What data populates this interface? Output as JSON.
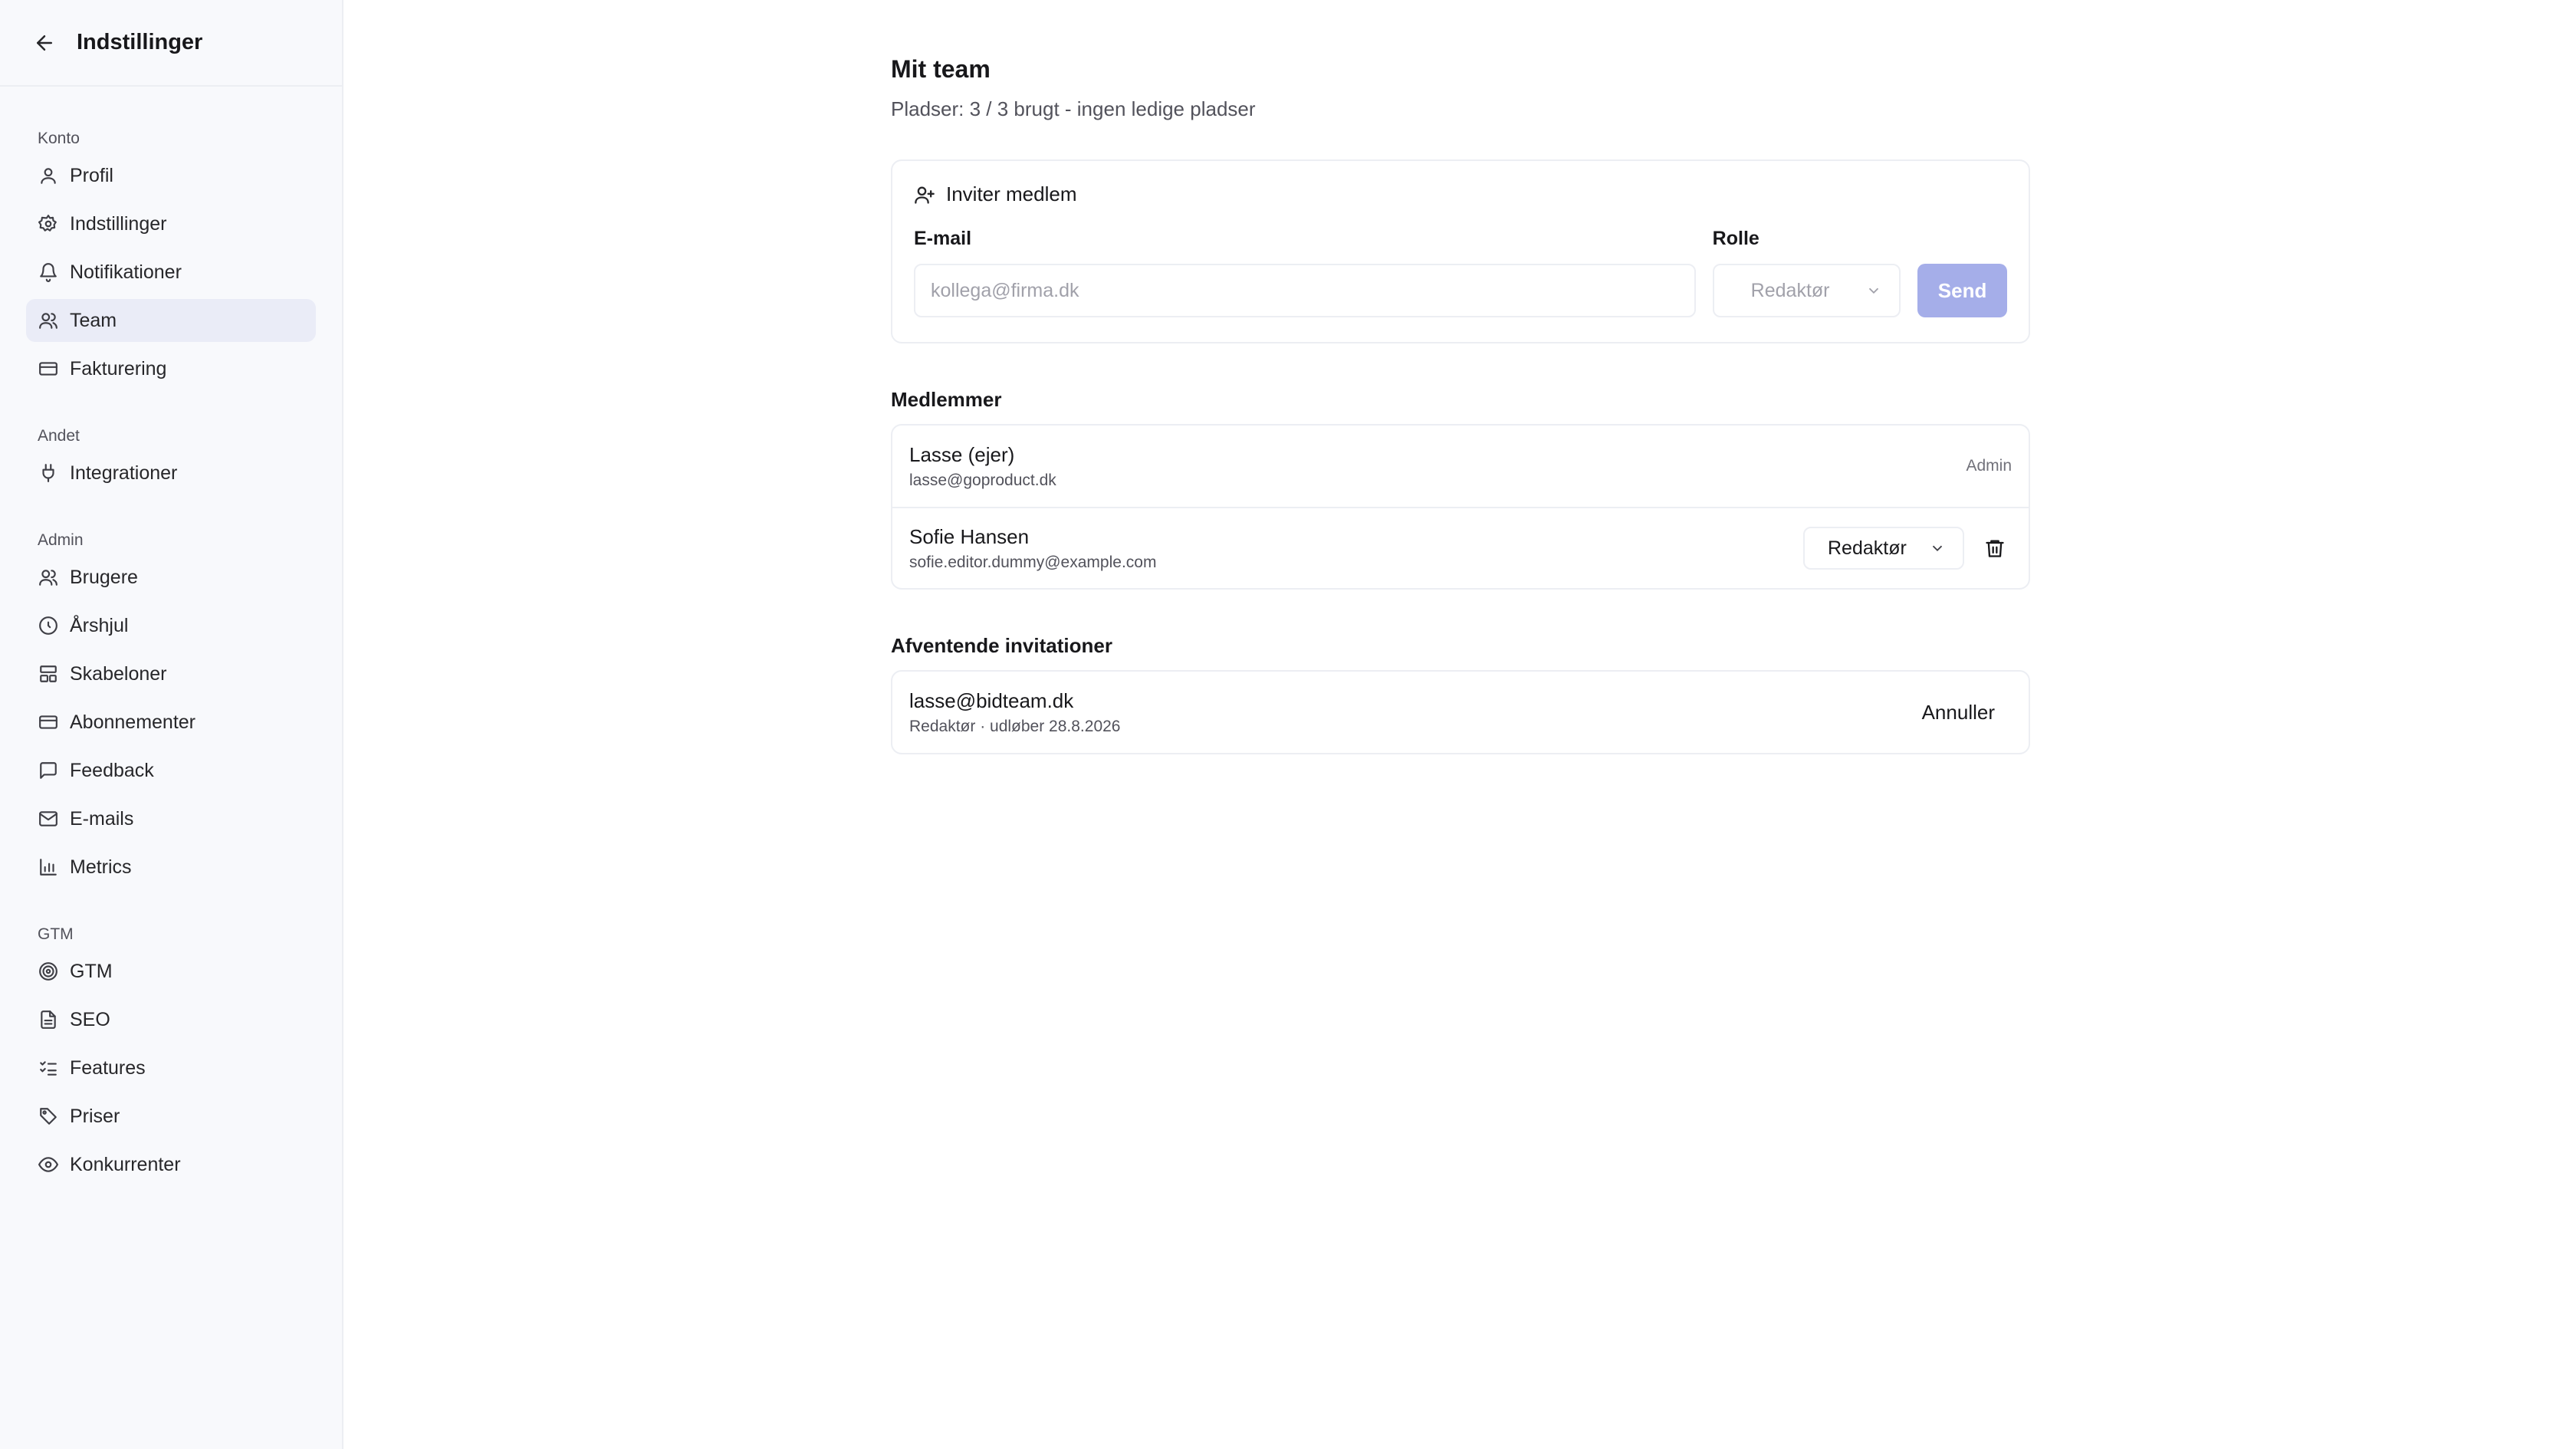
{
  "sidebar": {
    "title": "Indstillinger",
    "sections": [
      {
        "heading": "Konto",
        "items": [
          {
            "label": "Profil",
            "icon": "user-icon"
          },
          {
            "label": "Indstillinger",
            "icon": "gear-icon"
          },
          {
            "label": "Notifikationer",
            "icon": "bell-icon"
          },
          {
            "label": "Team",
            "icon": "users-icon",
            "active": true
          },
          {
            "label": "Fakturering",
            "icon": "credit-card-icon"
          }
        ]
      },
      {
        "heading": "Andet",
        "items": [
          {
            "label": "Integrationer",
            "icon": "plug-icon"
          }
        ]
      },
      {
        "heading": "Admin",
        "items": [
          {
            "label": "Brugere",
            "icon": "users-icon"
          },
          {
            "label": "Årshjul",
            "icon": "clock-circle-icon"
          },
          {
            "label": "Skabeloner",
            "icon": "layout-icon"
          },
          {
            "label": "Abonnementer",
            "icon": "credit-card-icon"
          },
          {
            "label": "Feedback",
            "icon": "message-icon"
          },
          {
            "label": "E-mails",
            "icon": "mail-icon"
          },
          {
            "label": "Metrics",
            "icon": "bar-chart-icon"
          }
        ]
      },
      {
        "heading": "GTM",
        "items": [
          {
            "label": "GTM",
            "icon": "target-icon"
          },
          {
            "label": "SEO",
            "icon": "file-text-icon"
          },
          {
            "label": "Features",
            "icon": "list-checks-icon"
          },
          {
            "label": "Priser",
            "icon": "tags-icon"
          },
          {
            "label": "Konkurrenter",
            "icon": "eye-icon"
          }
        ]
      }
    ]
  },
  "page": {
    "title": "Mit team",
    "subtitle": "Pladser: 3 / 3 brugt - ingen ledige pladser"
  },
  "invite": {
    "heading": "Inviter medlem",
    "email_label": "E-mail",
    "email_placeholder": "kollega@firma.dk",
    "email_value": "",
    "role_label": "Rolle",
    "role_value": "Redaktør",
    "send_label": "Send"
  },
  "members": {
    "heading": "Medlemmer",
    "rows": [
      {
        "name": "Lasse (ejer)",
        "email": "lasse@goproduct.dk",
        "role": "Admin"
      },
      {
        "name": "Sofie Hansen",
        "email": "sofie.editor.dummy@example.com",
        "role": "Redaktør"
      }
    ]
  },
  "pending": {
    "heading": "Afventende invitationer",
    "rows": [
      {
        "email": "lasse@bidteam.dk",
        "meta": "Redaktør · udløber 28.8.2026",
        "action": "Annuller"
      }
    ]
  },
  "colors": {
    "accent_disabled": "#a5aee9",
    "active_nav_bg": "#eaecf7",
    "sidebar_bg": "#f8f9fc"
  }
}
